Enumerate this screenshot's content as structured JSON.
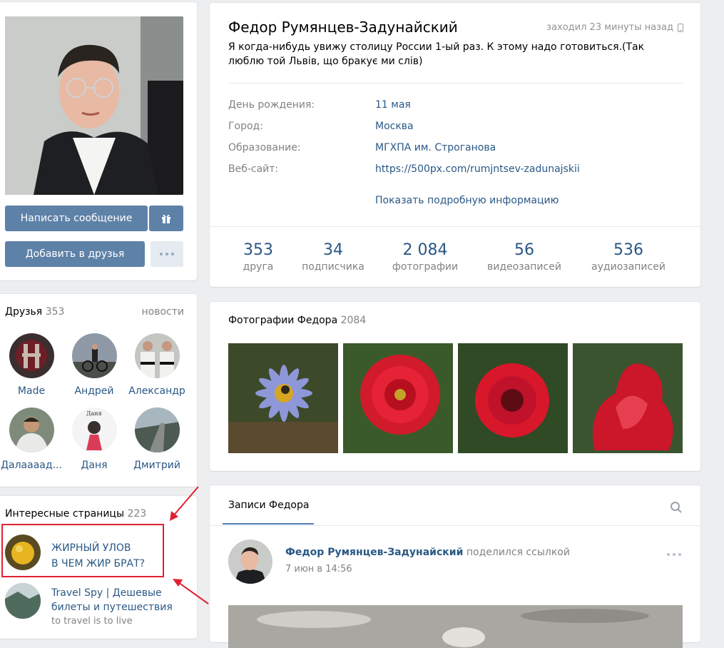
{
  "profile": {
    "message_button": "Написать сообщение",
    "add_friend_button": "Добавить в друзья",
    "gift_icon": "gift-icon",
    "more_icon": "more-icon"
  },
  "friends": {
    "title": "Друзья",
    "count": "353",
    "news_link": "новости",
    "items": [
      {
        "name": "Made"
      },
      {
        "name": "Андрей"
      },
      {
        "name": "Александр"
      },
      {
        "name": "Далаааад..."
      },
      {
        "name": "Даня"
      },
      {
        "name": "Дмитрий"
      }
    ]
  },
  "pages": {
    "title": "Интересные страницы",
    "count": "223",
    "items": [
      {
        "line1": "ЖИРНЫЙ УЛОВ",
        "line2": "В ЧЕМ ЖИР БРАТ?"
      },
      {
        "line1": "Travel Spy | Дешевые",
        "line2": "билеты и путешествия",
        "line3": "to travel is to live"
      }
    ]
  },
  "info": {
    "name": "Федор Румянцев-Задунайский",
    "last_seen": "заходил 23 минуты назад",
    "status": "Я когда-нибудь увижу столицу России 1-ый раз. К этому надо готовиться.(Так",
    "status2": "люблю той Львів, що бракує ми слів)",
    "rows": [
      {
        "label": "День рождения:",
        "value": "11 мая"
      },
      {
        "label": "Город:",
        "value": "Москва"
      },
      {
        "label": "Образование:",
        "value": "МГХПА им. Строганова"
      },
      {
        "label": "Веб-сайт:",
        "value": "https://500px.com/rumjntsev-zadunajskii"
      }
    ],
    "show_more": "Показать подробную информацию",
    "counters": [
      {
        "num": "353",
        "label": "друга"
      },
      {
        "num": "34",
        "label": "подписчика"
      },
      {
        "num": "2 084",
        "label": "фотографии"
      },
      {
        "num": "56",
        "label": "видеозаписей"
      },
      {
        "num": "536",
        "label": "аудиозаписей"
      }
    ]
  },
  "photos": {
    "title": "Фотографии Федора",
    "count": "2084"
  },
  "wall": {
    "tab": "Записи Федора",
    "post_author": "Федор Румянцев-Задунайский",
    "post_action": "поделился ссылкой",
    "post_date": "7 июн в 14:56"
  }
}
